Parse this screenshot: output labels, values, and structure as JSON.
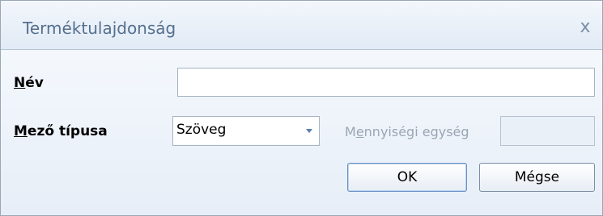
{
  "dialog": {
    "title": "Terméktulajdonság",
    "close_glyph": "x"
  },
  "fields": {
    "name_label_accel": "N",
    "name_label_rest": "év",
    "name_value": "",
    "type_label_accel": "M",
    "type_label_rest": "ező típusa",
    "type_value": "Szöveg",
    "unit_label_pre": "M",
    "unit_label_accel": "e",
    "unit_label_rest": "nnyiségi egység",
    "unit_value": ""
  },
  "buttons": {
    "ok_label": "OK",
    "cancel_label": "Mégse"
  },
  "icons": {
    "close": "close-icon",
    "dropdown": "chevron-down-icon"
  }
}
